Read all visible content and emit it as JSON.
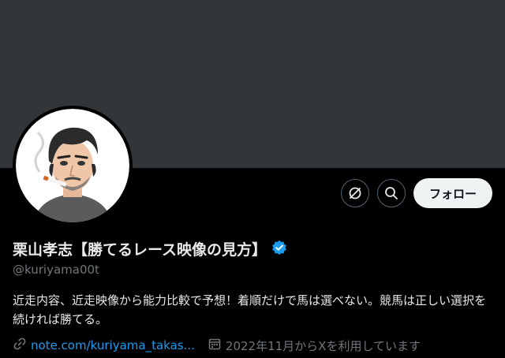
{
  "profile": {
    "display_name": "栗山孝志【勝てるレース映像の見方】",
    "handle": "@kuriyama00t",
    "bio": "近走内容、近走映像から能力比較で予想！着順だけで馬は選べない。競馬は正しい選択を続ければ勝てる。",
    "link_text": "note.com/kuriyama_takas...",
    "joined": "2022年11月からXを利用しています",
    "verified": true
  },
  "actions": {
    "follow_label": "フォロー",
    "icons": [
      "grok-icon",
      "search-icon"
    ]
  },
  "colors": {
    "banner": "#333639",
    "background": "#000000",
    "verified_badge": "#1d9bf0",
    "link": "#1d9bf0",
    "secondary_text": "#71767b"
  }
}
